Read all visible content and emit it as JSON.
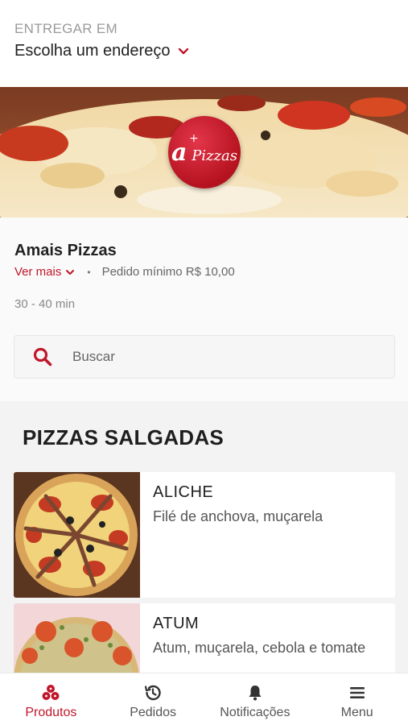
{
  "header": {
    "deliver_label": "ENTREGAR EM",
    "address_label": "Escolha um endereço"
  },
  "store": {
    "logo_text": "Pizzas",
    "logo_letter": "a",
    "logo_plus": "+",
    "name": "Amais Pizzas",
    "see_more": "Ver mais",
    "separator": "•",
    "min_order": "Pedido mínimo R$ 10,00",
    "delivery_time": "30 - 40 min"
  },
  "search": {
    "placeholder": "Buscar"
  },
  "catalog": {
    "section_title": "PIZZAS SALGADAS",
    "products": [
      {
        "name": "ALICHE",
        "description": "Filé de anchova, muçarela"
      },
      {
        "name": "ATUM",
        "description": "Atum, muçarela, cebola e tomate"
      }
    ]
  },
  "bottom_nav": {
    "items": [
      {
        "label": "Produtos",
        "icon": "pizza-slices-icon",
        "active": true
      },
      {
        "label": "Pedidos",
        "icon": "history-icon",
        "active": false
      },
      {
        "label": "Notificações",
        "icon": "bell-icon",
        "active": false
      },
      {
        "label": "Menu",
        "icon": "hamburger-menu-icon",
        "active": false
      }
    ]
  },
  "colors": {
    "accent": "#c0172b",
    "text": "#222222",
    "muted": "#888888",
    "section_bg": "#f3f3f3"
  }
}
